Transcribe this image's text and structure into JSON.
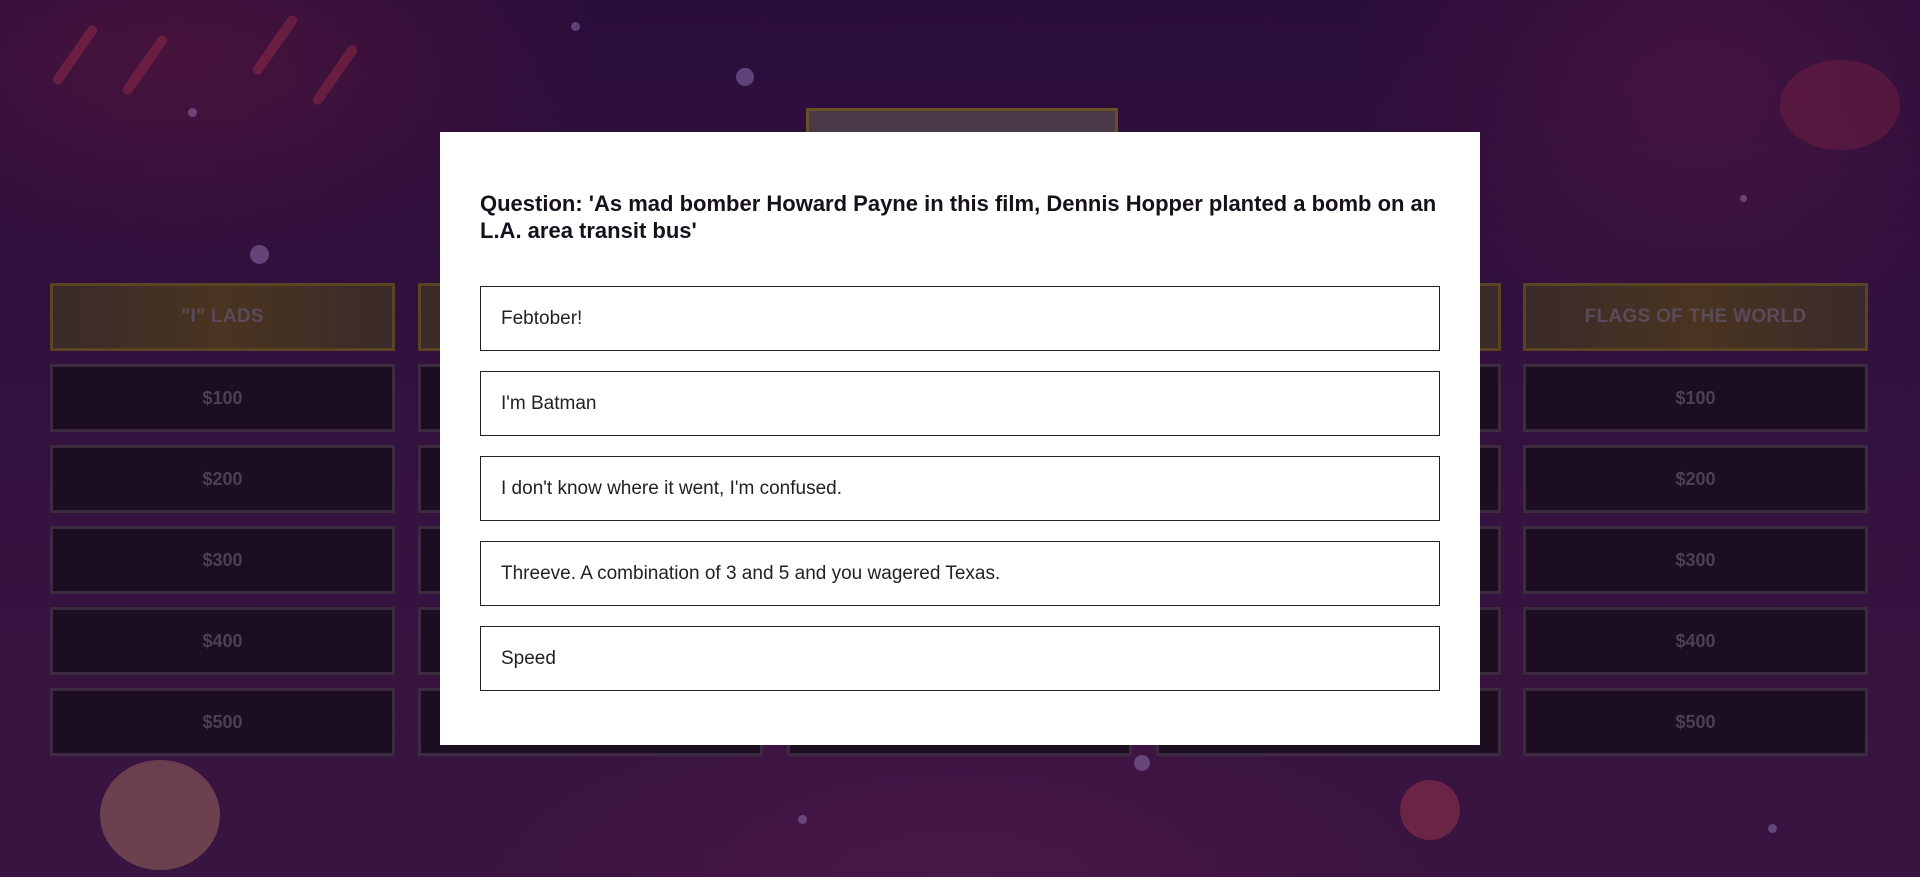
{
  "board": {
    "categories": [
      {
        "title": "\"I\" LADS",
        "values": [
          "$100",
          "$200",
          "$300",
          "$400",
          "$500"
        ]
      },
      {
        "title": "",
        "values": [
          "",
          "",
          "",
          "",
          ""
        ]
      },
      {
        "title": "",
        "values": [
          "",
          "",
          "",
          "",
          ""
        ]
      },
      {
        "title": "",
        "values": [
          "",
          "",
          "",
          "",
          ""
        ]
      },
      {
        "title": "FLAGS OF THE WORLD",
        "values": [
          "$100",
          "$200",
          "$300",
          "$400",
          "$500"
        ]
      }
    ]
  },
  "modal": {
    "question": "Question: 'As mad bomber Howard Payne in this film, Dennis Hopper planted a bomb on an L.A. area transit bus'",
    "answers": [
      "Febtober!",
      "I'm Batman",
      "I don't know where it went, I'm confused.",
      "Threeve. A combination of 3 and 5 and you wagered Texas.",
      "Speed"
    ]
  },
  "colors": {
    "background": "#2a0f3a",
    "category_border": "#5b4424",
    "tile_background": "#1c0d20",
    "modal_background": "#ffffff"
  }
}
